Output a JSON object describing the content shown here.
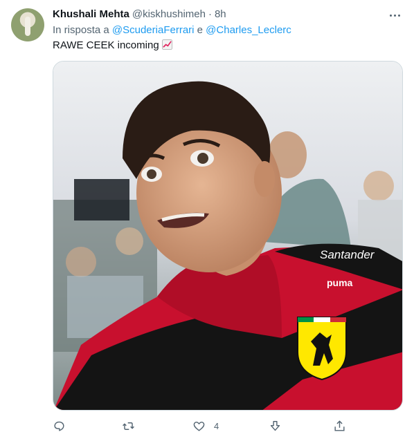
{
  "tweet": {
    "display_name": "Khushali Mehta",
    "handle": "@kiskhushimeh",
    "separator": "·",
    "time": "8h",
    "reply_prefix": "In risposta a",
    "reply_mention_1": "@ScuderiaFerrari",
    "reply_conjunction": "e",
    "reply_mention_2": "@Charles_Leclerc",
    "text": "RAWE CEEK incoming",
    "emoji": "chart-increasing-emoji",
    "media": {
      "sponsor_text": "Santander",
      "brand_text": "puma",
      "icon": "photo"
    }
  },
  "actions": {
    "reply_icon": "reply-icon",
    "retweet_icon": "retweet-icon",
    "like_icon": "like-icon",
    "like_count": "4",
    "downvote_icon": "downvote-icon",
    "share_icon": "share-icon"
  },
  "colors": {
    "link": "#1d9bf0",
    "secondary_text": "#536471",
    "primary_text": "#0f1419",
    "border": "#cfd9de",
    "ferrari_red": "#c8102e",
    "ferrari_yellow": "#ffe800"
  }
}
